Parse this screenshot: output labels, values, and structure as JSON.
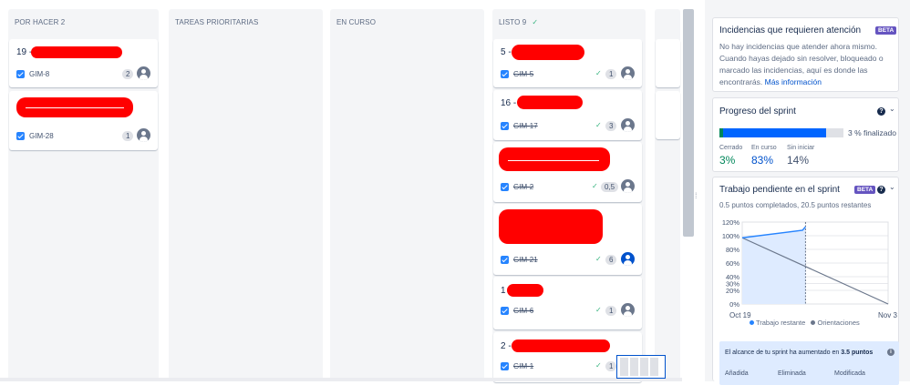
{
  "columns": [
    {
      "title": "POR HACER 2"
    },
    {
      "title": "TAREAS PRIORITARIAS"
    },
    {
      "title": "EN CURSO"
    },
    {
      "title": "LISTO 9",
      "check": "✓"
    }
  ],
  "todo_cards": [
    {
      "prefix": "19 -",
      "key": "GIM-8",
      "estimate": "2"
    },
    {
      "key": "GIM-28",
      "estimate": "1"
    }
  ],
  "done_cards": [
    {
      "prefix": "5 -",
      "key": "GIM-5",
      "estimate": "1"
    },
    {
      "prefix": "16 -",
      "key": "GIM-17",
      "estimate": "3"
    },
    {
      "key": "GIM-2",
      "estimate": "0,5"
    },
    {
      "key": "GIM-21",
      "estimate": "6"
    },
    {
      "prefix": "1",
      "key": "GIM-6",
      "estimate": "1"
    },
    {
      "prefix": "2 -",
      "key": "GIM-1",
      "estimate": "1"
    }
  ],
  "tick": "✓",
  "attention": {
    "title": "Incidencias que requieren atención",
    "beta": "BETA",
    "text": "No hay incidencias que atender ahora mismo. Cuando hayas dejado sin resolver, bloqueado o marcado las incidencias, aquí es donde las encontrarás.",
    "link": "Más información"
  },
  "progress": {
    "title": "Progreso del sprint",
    "help": "?",
    "chevron": "⌄",
    "done_fraction": 0.03,
    "in_progress_fraction": 0.83,
    "label": "3 % finalizado",
    "stats": [
      {
        "label": "Cerrado",
        "value": "3%",
        "color": "#00875a"
      },
      {
        "label": "En curso",
        "value": "83%",
        "color": "#0052cc"
      },
      {
        "label": "Sin iniciar",
        "value": "14%",
        "color": "#42526e"
      }
    ]
  },
  "burndown": {
    "title": "Trabajo pendiente en el sprint",
    "beta": "BETA",
    "help": "?",
    "chevron": "⌄",
    "subtitle": "0.5 puntos completados, 20.5 puntos restantes",
    "scope_text_prefix": "El alcance de tu sprint ha aumentado en ",
    "scope_text_value": "3.5 puntos",
    "scope_info": "i",
    "scope_cols": [
      "Añadida",
      "Eliminada",
      "Modificada"
    ]
  },
  "chart_data": {
    "type": "line",
    "ylim": [
      0,
      120
    ],
    "yticks": [
      "120%",
      "100%",
      "80%",
      "60%",
      "40%",
      "30%",
      "20%",
      "0%"
    ],
    "ytick_values": [
      120,
      100,
      80,
      60,
      40,
      30,
      20,
      0
    ],
    "x_labels": [
      "Oct 19",
      "Nov 3"
    ],
    "x_range": [
      0,
      15
    ],
    "series": [
      {
        "name": "Trabajo restante",
        "color": "#2684ff",
        "points": [
          [
            0,
            97
          ],
          [
            6.2,
            108
          ],
          [
            6.5,
            113
          ]
        ]
      },
      {
        "name": "Orientaciones",
        "color": "#6b778c",
        "points": [
          [
            0,
            97
          ],
          [
            15,
            0
          ]
        ]
      }
    ],
    "today_x": 6.5
  }
}
